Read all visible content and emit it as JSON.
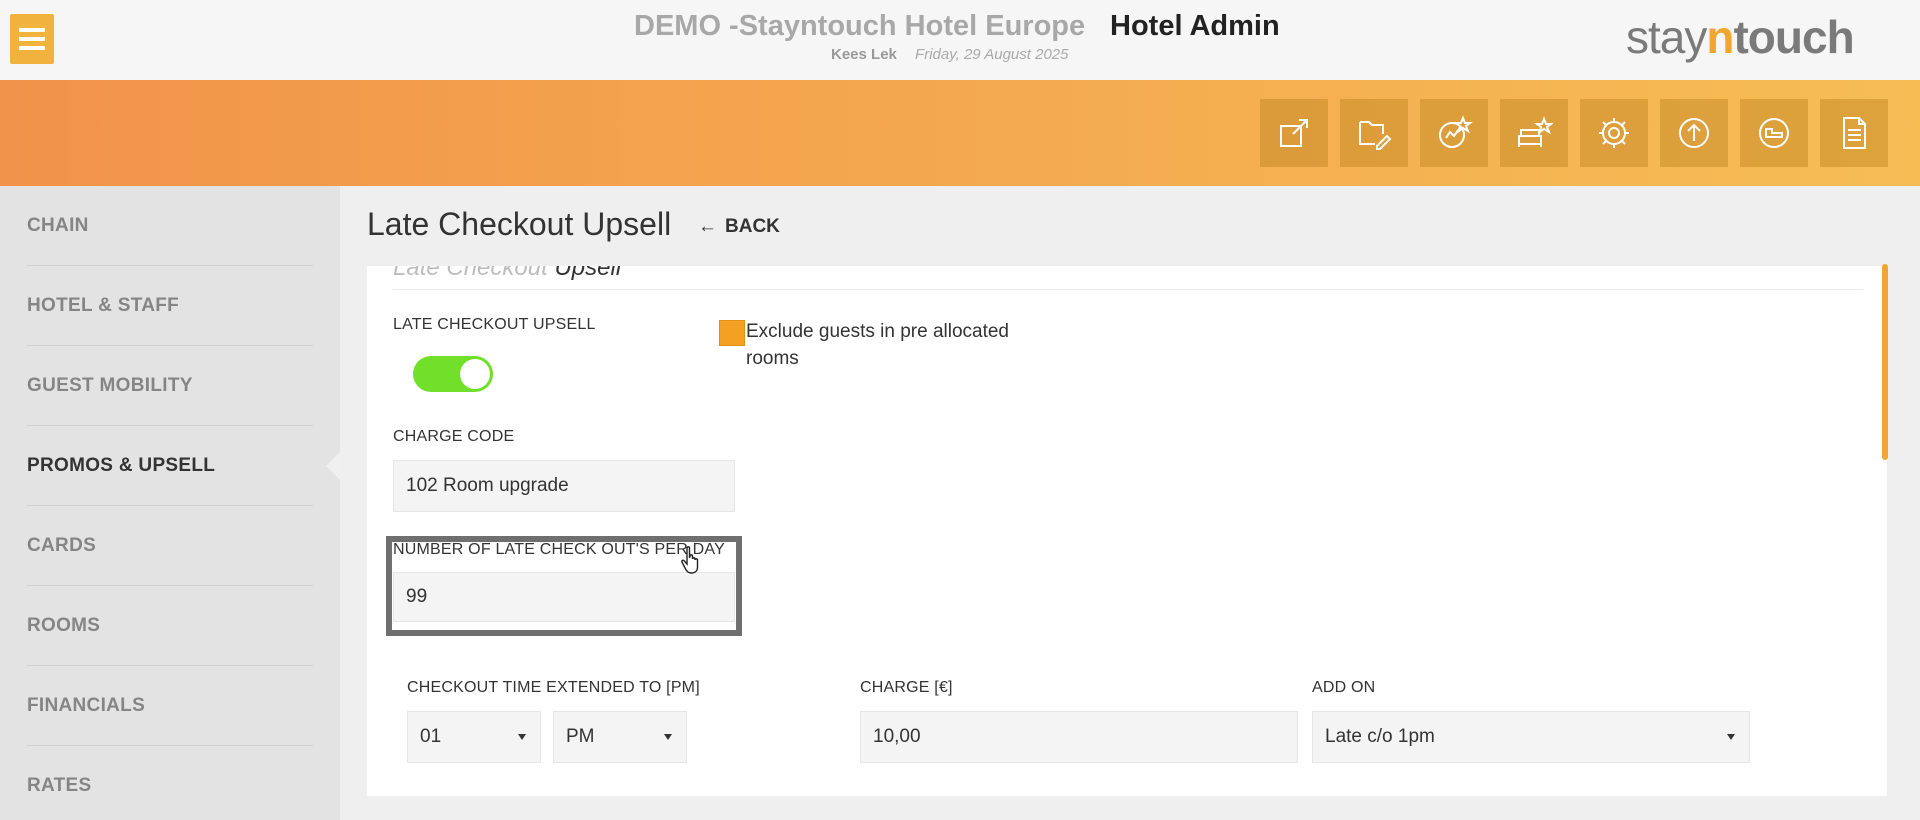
{
  "header": {
    "hotel_name": "DEMO -Stayntouch Hotel Europe",
    "app_name": "Hotel Admin",
    "user": "Kees Lek",
    "date": "Friday, 29 August 2025",
    "logo": {
      "part1": "stay",
      "part2": "n",
      "part3": "touch"
    }
  },
  "toolbar": {
    "icons": [
      "external-link-icon",
      "folder-edit-icon",
      "chart-star-icon",
      "sofa-star-icon",
      "gear-icon",
      "upload-circle-icon",
      "bed-circle-icon",
      "document-icon"
    ]
  },
  "sidebar": {
    "items": [
      {
        "label": "CHAIN"
      },
      {
        "label": "HOTEL & STAFF"
      },
      {
        "label": "GUEST MOBILITY"
      },
      {
        "label": "PROMOS & UPSELL",
        "active": true
      },
      {
        "label": "CARDS"
      },
      {
        "label": "ROOMS"
      },
      {
        "label": "FINANCIALS"
      },
      {
        "label": "RATES"
      }
    ]
  },
  "main": {
    "title": "Late Checkout Upsell",
    "back_label": "BACK",
    "section_heading_muted": "Late Checkout",
    "section_heading_strong": "Upsell",
    "toggle": {
      "label": "LATE CHECKOUT UPSELL",
      "on": true
    },
    "exclude_checkbox": {
      "label": "Exclude guests in pre allocated rooms",
      "checked": true
    },
    "charge_code": {
      "label": "CHARGE CODE",
      "value": "102 Room upgrade"
    },
    "late_checkouts": {
      "label": "NUMBER OF LATE CHECK OUT'S PER DAY",
      "value": "99"
    },
    "checkout_time": {
      "label": "CHECKOUT TIME EXTENDED TO [PM]",
      "hour": "01",
      "ampm": "PM"
    },
    "charge": {
      "label": "CHARGE [€]",
      "value": "10,00"
    },
    "add_on": {
      "label": "ADD ON",
      "value": "Late c/o 1pm"
    }
  },
  "colors": {
    "accent": "#f3a531",
    "toggle_on": "#72e02b",
    "band_start": "#f1934a",
    "band_end": "#f6bd55"
  }
}
